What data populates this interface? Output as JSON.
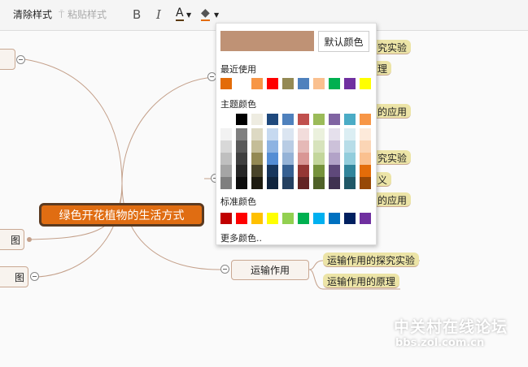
{
  "toolbar": {
    "clear_style": "清除样式",
    "paste_style": "粘贴样式",
    "bold": "B",
    "italic": "I",
    "font_color": "A"
  },
  "mindmap": {
    "center": "绿色开花植物的生活方式",
    "left_nodes": [
      "",
      "图",
      "图"
    ],
    "transport_node": "运输作用",
    "transport_leaves": [
      "运输作用的探究实验",
      "运输作用的原理"
    ],
    "right_leaves_partial": [
      "究实验",
      "理",
      "的应用",
      "究实验",
      "义",
      "的应用"
    ]
  },
  "popup": {
    "preview_color": "#bf9275",
    "default_button": "默认颜色",
    "recent_label": "最近使用",
    "recent": [
      "#e36c09",
      "#ffffff",
      "#f79646",
      "#ff0000",
      "#948a54",
      "#4f81bd",
      "#fac08f",
      "#00b050",
      "#7030a0",
      "#ffff00"
    ],
    "theme_label": "主题颜色",
    "theme_top": [
      "#ffffff",
      "#000000",
      "#eeece1",
      "#1f497d",
      "#4f81bd",
      "#c0504d",
      "#9bbb59",
      "#8064a2",
      "#4bacc6",
      "#f79646"
    ],
    "theme_shades": [
      [
        "#f2f2f2",
        "#d8d8d8",
        "#bfbfbf",
        "#a5a5a5",
        "#7f7f7f"
      ],
      [
        "#7f7f7f",
        "#595959",
        "#3f3f3f",
        "#262626",
        "#0c0c0c"
      ],
      [
        "#ddd9c3",
        "#c4bd97",
        "#938953",
        "#494429",
        "#1d1b10"
      ],
      [
        "#c6d9f0",
        "#8db3e2",
        "#548dd4",
        "#17365d",
        "#0f243e"
      ],
      [
        "#dbe5f1",
        "#b8cce4",
        "#95b3d7",
        "#366092",
        "#244061"
      ],
      [
        "#f2dcdb",
        "#e5b9b7",
        "#d99694",
        "#953734",
        "#632423"
      ],
      [
        "#ebf1dd",
        "#d7e3bc",
        "#c3d69b",
        "#76923c",
        "#4f6128"
      ],
      [
        "#e5e0ec",
        "#ccc1d9",
        "#b2a2c7",
        "#5f497a",
        "#3f3151"
      ],
      [
        "#dbeef3",
        "#b7dde8",
        "#92cddc",
        "#31859b",
        "#205867"
      ],
      [
        "#fdeada",
        "#fbd5b5",
        "#fac08f",
        "#e36c09",
        "#974806"
      ]
    ],
    "standard_label": "标准颜色",
    "standard": [
      "#c00000",
      "#ff0000",
      "#ffc000",
      "#ffff00",
      "#92d050",
      "#00b050",
      "#00b0f0",
      "#0070c0",
      "#002060",
      "#7030a0"
    ],
    "more_colors": "更多颜色.."
  },
  "watermark": {
    "title": "中关村在线论坛",
    "url": "bbs.zol.com.cn"
  }
}
